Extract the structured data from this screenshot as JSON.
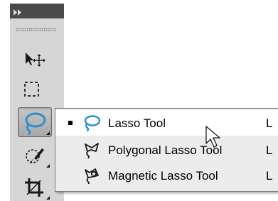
{
  "toolbar": {
    "collapse_icon": "double-chevron-right-icon",
    "tools": [
      {
        "name": "move-tool",
        "icon": "move-arrow-icon",
        "active": false
      },
      {
        "name": "marquee-tool",
        "icon": "rectangular-marquee-icon",
        "active": false
      },
      {
        "name": "lasso-tool",
        "icon": "lasso-icon",
        "active": true
      },
      {
        "name": "quick-selection-tool",
        "icon": "quick-selection-brush-icon",
        "active": false
      },
      {
        "name": "crop-tool",
        "icon": "crop-icon",
        "active": false
      }
    ]
  },
  "flyout": {
    "items": [
      {
        "label": "Lasso Tool",
        "shortcut": "L",
        "icon": "lasso-icon",
        "selected": true
      },
      {
        "label": "Polygonal Lasso Tool",
        "shortcut": "L",
        "icon": "polygonal-lasso-icon",
        "selected": false
      },
      {
        "label": "Magnetic Lasso Tool",
        "shortcut": "L",
        "icon": "magnetic-lasso-icon",
        "selected": false
      }
    ]
  },
  "colors": {
    "header_bg": "#4a4a4a",
    "panel_bg": "#d6d6d6",
    "menu_bg": "#ececec",
    "menu_hover_bg": "#ffffff",
    "lasso_blue": "#2f8fd0"
  },
  "cursor": {
    "icon": "arrow-pointer-icon"
  }
}
